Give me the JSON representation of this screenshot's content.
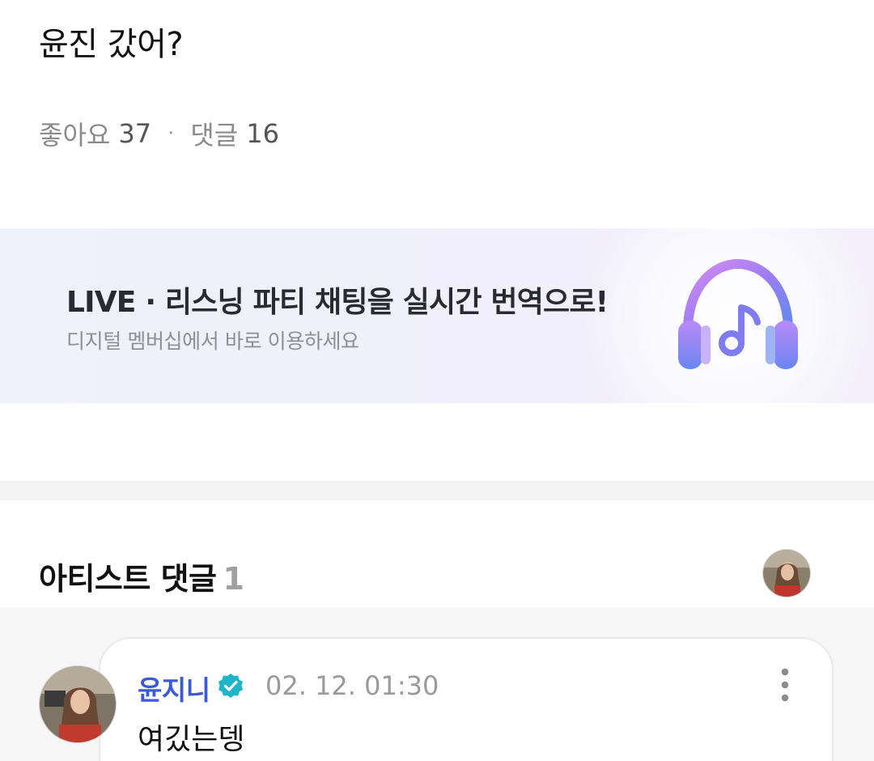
{
  "post": {
    "title": "윤진 갔어?",
    "likes_label": "좋아요",
    "likes_count": "37",
    "separator": "·",
    "comments_label": "댓글",
    "comments_count": "16"
  },
  "banner": {
    "title": "LIVE · 리스닝 파티 채팅을 실시간 번역으로!",
    "subtitle": "디지털 멤버십에서 바로 이용하세요",
    "icon": "headphones-music-icon"
  },
  "artist_comments": {
    "heading": "아티스트 댓글",
    "count": "1",
    "comment": {
      "author": "윤지니",
      "verified": true,
      "timestamp": "02. 12. 01:30",
      "text": "여깄는뎅"
    }
  },
  "colors": {
    "author": "#3b5bd6",
    "verified_badge": "#1fb5c9",
    "banner_bg": "#eff1fb",
    "icon_gradient_start": "#c17bf2",
    "icon_gradient_end": "#5b8cf0"
  }
}
